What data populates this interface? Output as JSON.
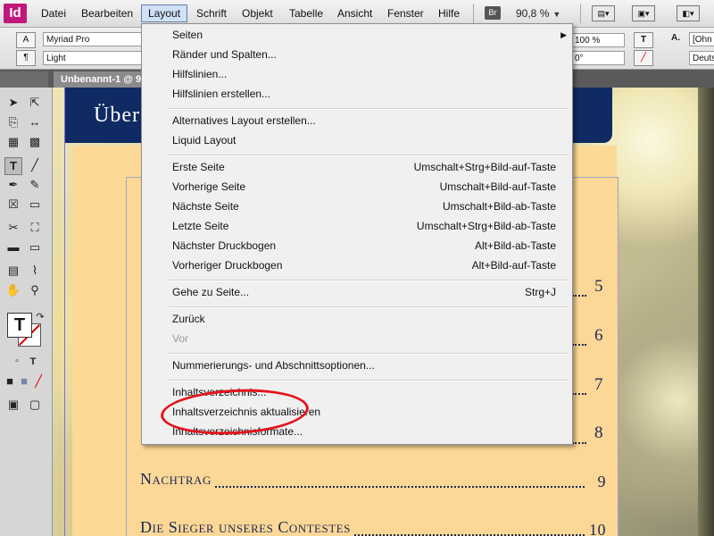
{
  "app": {
    "logo": "Id"
  },
  "menubar": {
    "items": [
      "Datei",
      "Bearbeiten",
      "Layout",
      "Schrift",
      "Objekt",
      "Tabelle",
      "Ansicht",
      "Fenster",
      "Hilfe"
    ],
    "active": "Layout",
    "bridge_label": "Br",
    "zoom": "90,8 %"
  },
  "control": {
    "font_family": "Myriad Pro",
    "font_style": "Light",
    "scale": "100 %",
    "angle": "0°",
    "char_style": "[Ohn",
    "language": "Deuts"
  },
  "document": {
    "tab_title": "Unbenannt-1 @ 9",
    "banner_title": "Über",
    "toc_numbers_visible": [
      "5",
      "6",
      "7",
      "8"
    ],
    "toc_rows": [
      {
        "title": "Nachtrag",
        "page": "9"
      },
      {
        "title": "Die Sieger unseres Contestes",
        "page": "10"
      }
    ]
  },
  "layout_menu": {
    "groups": [
      [
        {
          "label": "Seiten",
          "submenu": true
        },
        {
          "label": "Ränder und Spalten..."
        },
        {
          "label": "Hilfslinien..."
        },
        {
          "label": "Hilfslinien erstellen..."
        }
      ],
      [
        {
          "label": "Alternatives Layout erstellen..."
        },
        {
          "label": "Liquid Layout"
        }
      ],
      [
        {
          "label": "Erste Seite",
          "shortcut": "Umschalt+Strg+Bild-auf-Taste"
        },
        {
          "label": "Vorherige Seite",
          "shortcut": "Umschalt+Bild-auf-Taste"
        },
        {
          "label": "Nächste Seite",
          "shortcut": "Umschalt+Bild-ab-Taste"
        },
        {
          "label": "Letzte Seite",
          "shortcut": "Umschalt+Strg+Bild-ab-Taste"
        },
        {
          "label": "Nächster Druckbogen",
          "shortcut": "Alt+Bild-ab-Taste"
        },
        {
          "label": "Vorheriger Druckbogen",
          "shortcut": "Alt+Bild-auf-Taste"
        }
      ],
      [
        {
          "label": "Gehe zu Seite...",
          "shortcut": "Strg+J"
        }
      ],
      [
        {
          "label": "Zurück"
        },
        {
          "label": "Vor",
          "disabled": true
        }
      ],
      [
        {
          "label": "Nummerierungs- und Abschnittsoptionen..."
        }
      ],
      [
        {
          "label": "Inhaltsverzeichnis..."
        },
        {
          "label": "Inhaltsverzeichnis aktualisieren"
        },
        {
          "label": "Inhaltsverzeichnisformate..."
        }
      ]
    ]
  },
  "colors": {
    "accent": "#cfe0f7",
    "banner": "#102b63",
    "page": "#fdd796",
    "highlight": "#e4141e"
  }
}
